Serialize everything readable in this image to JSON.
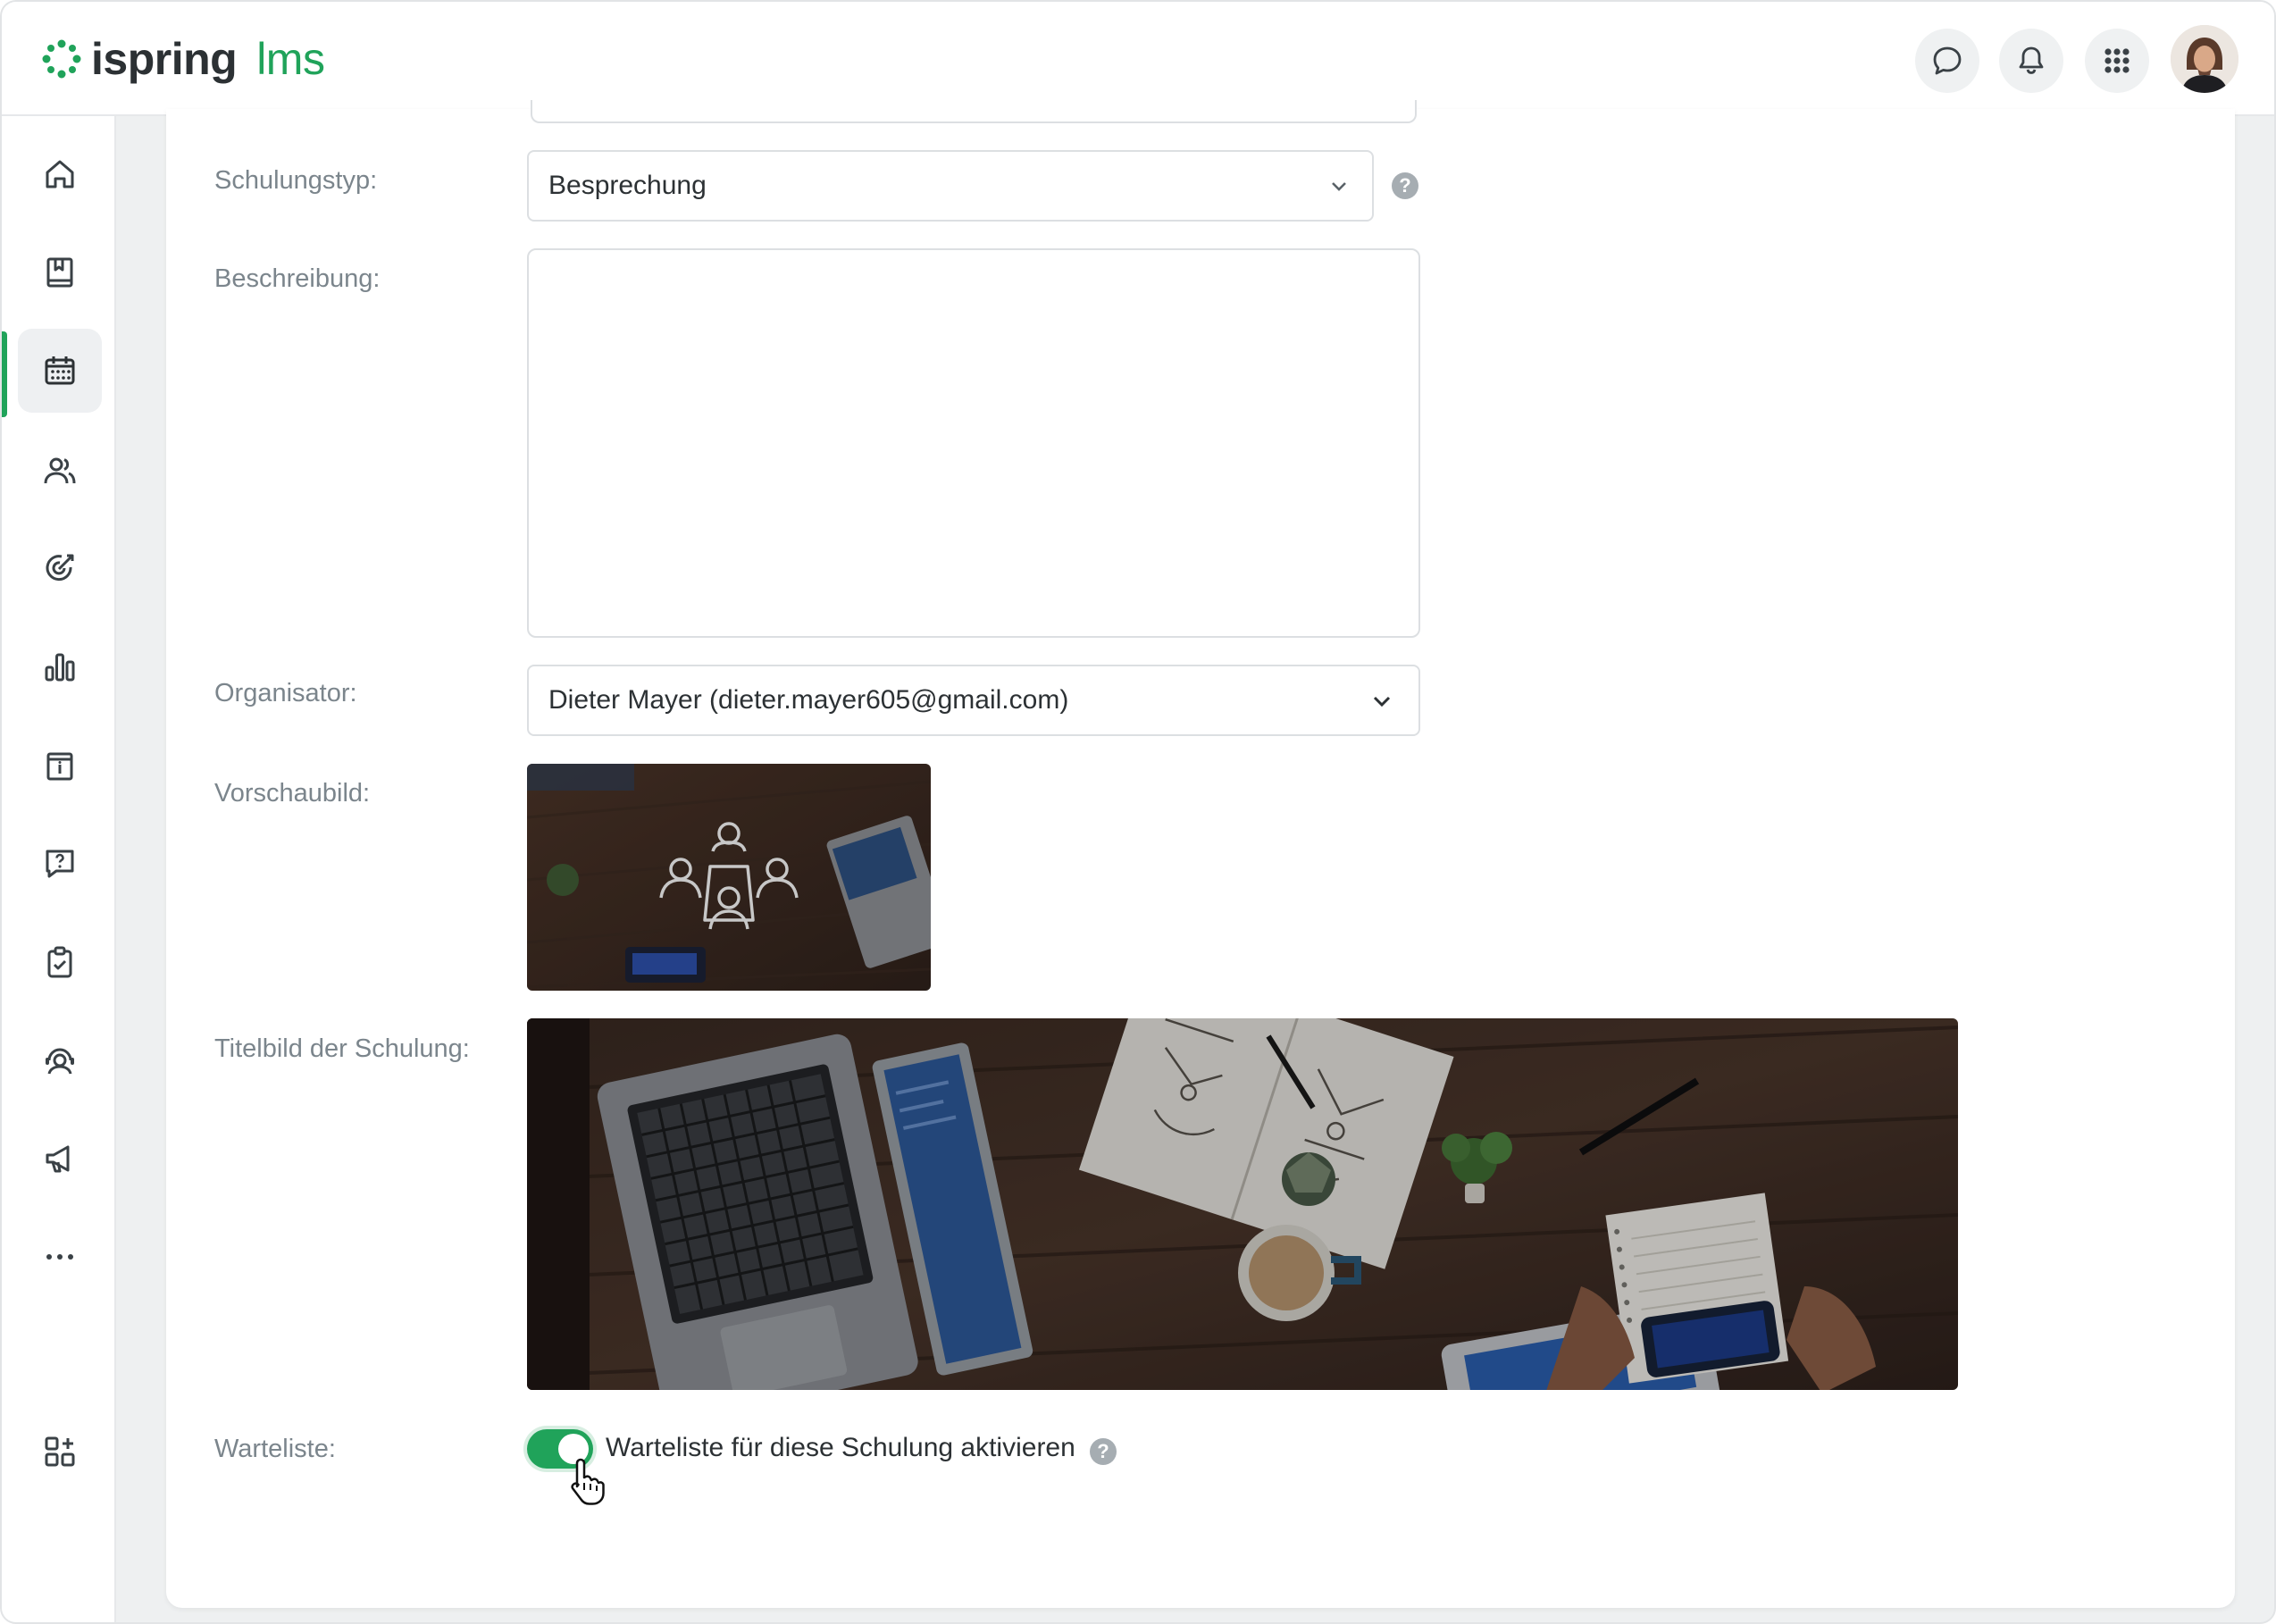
{
  "app": {
    "logo_text": "ispring",
    "logo_suffix": "lms",
    "accent_color": "#20a35a"
  },
  "header": {
    "icons": [
      "chat-icon",
      "bell-icon",
      "apps-grid-icon"
    ],
    "avatar": "user-avatar"
  },
  "sidebar": {
    "items": [
      {
        "icon": "home-icon",
        "active": false
      },
      {
        "icon": "book-icon",
        "active": false
      },
      {
        "icon": "calendar-icon",
        "active": true
      },
      {
        "icon": "users-icon",
        "active": false
      },
      {
        "icon": "target-icon",
        "active": false
      },
      {
        "icon": "bar-chart-icon",
        "active": false
      },
      {
        "icon": "info-board-icon",
        "active": false
      },
      {
        "icon": "question-chat-icon",
        "active": false
      },
      {
        "icon": "clipboard-check-icon",
        "active": false
      },
      {
        "icon": "support-agent-icon",
        "active": false
      },
      {
        "icon": "megaphone-icon",
        "active": false
      },
      {
        "icon": "more-dots-icon",
        "active": false
      },
      {
        "icon": "add-widgets-icon",
        "active": false
      }
    ]
  },
  "form": {
    "training_type": {
      "label": "Schulungstyp:",
      "value": "Besprechung"
    },
    "description": {
      "label": "Beschreibung:",
      "value": ""
    },
    "organizer": {
      "label": "Organisator:",
      "value": "Dieter Mayer (dieter.mayer605@gmail.com)"
    },
    "preview_image": {
      "label": "Vorschaubild:"
    },
    "cover_image": {
      "label": "Titelbild der Schulung:"
    },
    "waitlist": {
      "label": "Warteliste:",
      "toggle_label": "Warteliste für diese Schulung aktivieren",
      "enabled": true
    }
  }
}
